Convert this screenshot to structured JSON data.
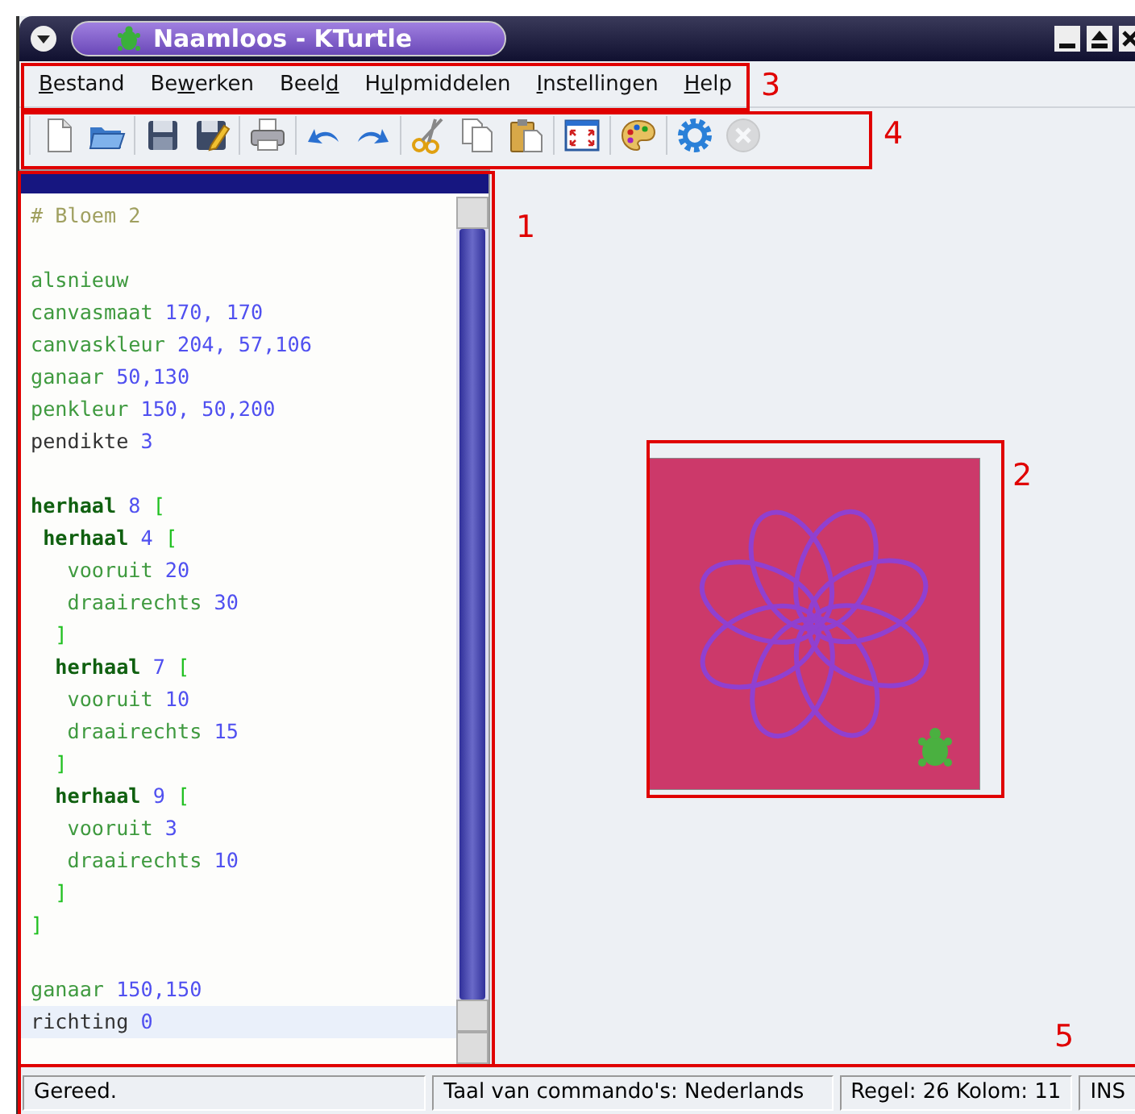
{
  "window": {
    "title": "Naamloos - KTurtle"
  },
  "menu": [
    {
      "key": "B",
      "after": "estand"
    },
    {
      "before": "Be",
      "key": "w",
      "after": "erken"
    },
    {
      "before": "Beel",
      "key": "d"
    },
    {
      "before": "H",
      "key": "u",
      "after": "lpmiddelen"
    },
    {
      "key": "I",
      "after": "nstellingen"
    },
    {
      "key": "H",
      "after": "elp"
    }
  ],
  "toolbar": [
    [
      {
        "disabled": false
      },
      {
        "disabled": false
      }
    ],
    [
      {
        "disabled": false
      },
      {
        "disabled": false
      }
    ],
    [
      {
        "disabled": false
      }
    ],
    [
      {
        "disabled": false
      },
      {
        "disabled": false
      }
    ],
    [
      {
        "disabled": false
      },
      {
        "disabled": false
      },
      {
        "disabled": false
      }
    ],
    [
      {
        "disabled": false
      }
    ],
    [
      {
        "disabled": false
      }
    ],
    [
      {
        "disabled": false
      },
      {
        "disabled": true
      }
    ]
  ],
  "editor": {
    "lines": [
      {
        "current": false,
        "tokens": [
          {
            "kind": "comment",
            "text": "# Bloem 2"
          }
        ]
      },
      {
        "current": false
      },
      {
        "current": false,
        "tokens": [
          {
            "kind": "command",
            "text": "alsnieuw"
          }
        ]
      },
      {
        "current": false,
        "tokens": [
          {
            "kind": "command",
            "text": "canvasmaat"
          },
          {
            "kind": "number",
            "text": "170, 170"
          }
        ]
      },
      {
        "current": false,
        "tokens": [
          {
            "kind": "command",
            "text": "canvaskleur"
          },
          {
            "kind": "number",
            "text": "204, 57,106"
          }
        ]
      },
      {
        "current": false,
        "tokens": [
          {
            "kind": "command",
            "text": "ganaar"
          },
          {
            "kind": "number",
            "text": "50,130"
          }
        ]
      },
      {
        "current": false,
        "tokens": [
          {
            "kind": "command",
            "text": "penkleur"
          },
          {
            "kind": "number",
            "text": "150, 50,200"
          }
        ]
      },
      {
        "current": false,
        "tokens": [
          {
            "kind": "plain",
            "text": "pendikte"
          },
          {
            "kind": "number",
            "text": "3"
          }
        ]
      },
      {
        "current": false
      },
      {
        "current": false,
        "tokens": [
          {
            "kind": "keyword",
            "text": "herhaal"
          },
          {
            "kind": "number",
            "text": "8"
          },
          {
            "kind": "bracket",
            "text": "["
          }
        ]
      },
      {
        "current": false,
        "tokens": [
          {
            "kind": "keyword",
            "text": " herhaal"
          },
          {
            "kind": "number",
            "text": "4"
          },
          {
            "kind": "bracket",
            "text": "["
          }
        ]
      },
      {
        "current": false,
        "tokens": [
          {
            "kind": "command",
            "text": "   vooruit"
          },
          {
            "kind": "number",
            "text": "20"
          }
        ]
      },
      {
        "current": false,
        "tokens": [
          {
            "kind": "command",
            "text": "   draairechts"
          },
          {
            "kind": "number",
            "text": "30"
          }
        ]
      },
      {
        "current": false,
        "tokens": [
          {
            "kind": "bracket",
            "text": "  ]"
          }
        ]
      },
      {
        "current": false,
        "tokens": [
          {
            "kind": "keyword",
            "text": "  herhaal"
          },
          {
            "kind": "number",
            "text": "7"
          },
          {
            "kind": "bracket",
            "text": "["
          }
        ]
      },
      {
        "current": false,
        "tokens": [
          {
            "kind": "command",
            "text": "   vooruit"
          },
          {
            "kind": "number",
            "text": "10"
          }
        ]
      },
      {
        "current": false,
        "tokens": [
          {
            "kind": "command",
            "text": "   draairechts"
          },
          {
            "kind": "number",
            "text": "15"
          }
        ]
      },
      {
        "current": false,
        "tokens": [
          {
            "kind": "bracket",
            "text": "  ]"
          }
        ]
      },
      {
        "current": false,
        "tokens": [
          {
            "kind": "keyword",
            "text": "  herhaal"
          },
          {
            "kind": "number",
            "text": "9"
          },
          {
            "kind": "bracket",
            "text": "["
          }
        ]
      },
      {
        "current": false,
        "tokens": [
          {
            "kind": "command",
            "text": "   vooruit"
          },
          {
            "kind": "number",
            "text": "3"
          }
        ]
      },
      {
        "current": false,
        "tokens": [
          {
            "kind": "command",
            "text": "   draairechts"
          },
          {
            "kind": "number",
            "text": "10"
          }
        ]
      },
      {
        "current": false,
        "tokens": [
          {
            "kind": "bracket",
            "text": "  ]"
          }
        ]
      },
      {
        "current": false,
        "tokens": [
          {
            "kind": "bracket",
            "text": "]"
          }
        ]
      },
      {
        "current": false
      },
      {
        "current": false,
        "tokens": [
          {
            "kind": "command",
            "text": "ganaar"
          },
          {
            "kind": "number",
            "text": "150,150"
          }
        ]
      },
      {
        "current": true,
        "tokens": [
          {
            "kind": "plain",
            "text": "richting"
          },
          {
            "kind": "number",
            "text": "0"
          }
        ]
      }
    ]
  },
  "status_bar": {
    "message": "Gereed.",
    "language": "Taal van commando's: Nederlands",
    "position": "Regel: 26 Kolom: 11",
    "mode": "INS"
  },
  "annotations": [
    {
      "label": "1"
    },
    {
      "label": "2"
    },
    {
      "label": "3"
    },
    {
      "label": "4"
    },
    {
      "label": "5"
    }
  ]
}
